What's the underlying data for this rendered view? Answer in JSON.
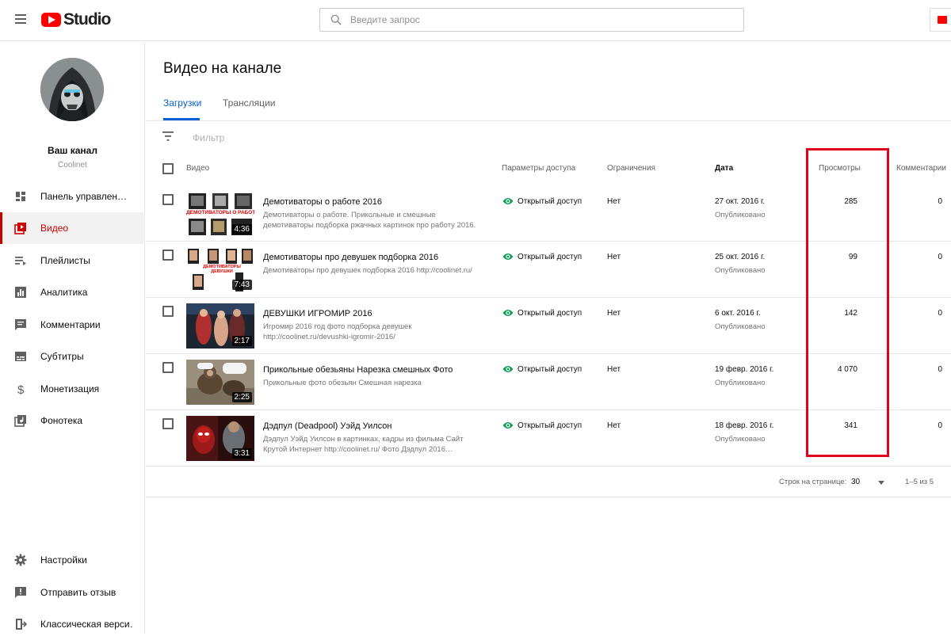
{
  "header": {
    "logo_text": "Studio",
    "search_placeholder": "Введите запрос"
  },
  "channel": {
    "name": "Ваш канал",
    "handle": "Coolinet"
  },
  "sidebar": {
    "items": [
      {
        "label": "Панель управлен…",
        "icon": "dashboard-icon"
      },
      {
        "label": "Видео",
        "icon": "video-icon",
        "active": true
      },
      {
        "label": "Плейлисты",
        "icon": "playlist-icon"
      },
      {
        "label": "Аналитика",
        "icon": "analytics-icon"
      },
      {
        "label": "Комментарии",
        "icon": "comments-icon"
      },
      {
        "label": "Субтитры",
        "icon": "subtitles-icon"
      },
      {
        "label": "Монетизация",
        "icon": "dollar-icon"
      },
      {
        "label": "Фонотека",
        "icon": "audio-library-icon"
      }
    ],
    "bottom_items": [
      {
        "label": "Настройки",
        "icon": "gear-icon"
      },
      {
        "label": "Отправить отзыв",
        "icon": "feedback-icon"
      },
      {
        "label": "Классическая верси…",
        "icon": "exit-icon"
      }
    ]
  },
  "main": {
    "title": "Видео на канале",
    "tabs": [
      {
        "label": "Загрузки",
        "active": true
      },
      {
        "label": "Трансляции"
      }
    ],
    "filter_placeholder": "Фильтр",
    "columns": {
      "video": "Видео",
      "visibility": "Параметры доступа",
      "restrictions": "Ограничения",
      "date": "Дата",
      "views": "Просмотры",
      "comments": "Комментарии"
    },
    "rows": [
      {
        "title": "Демотиваторы о работе 2016",
        "description": "Демотиваторы о работе. Прикольные и смешные демотиваторы подборка ржачных картинок про работу 2016.",
        "duration": "4:36",
        "visibility": "Открытый доступ",
        "restrictions": "Нет",
        "date": "27 окт. 2016 г.",
        "date_status": "Опубликовано",
        "views": "285",
        "comments": "0",
        "thumb_text": "ДЕМОТИВАТОРЫ О РАБОТЕ"
      },
      {
        "title": "Демотиваторы про девушек подборка 2016",
        "description": "Демотиваторы про девушек подборка 2016 http://coolinet.ru/",
        "duration": "7:43",
        "visibility": "Открытый доступ",
        "restrictions": "Нет",
        "date": "25 окт. 2016 г.",
        "date_status": "Опубликовано",
        "views": "99",
        "comments": "0",
        "thumb_text": "ДЕМОТИВАТОРЫ ДЕВУШКИ"
      },
      {
        "title": "ДЕВУШКИ ИГРОМИР 2016",
        "description": "Игромир 2016 год фото подборка девушек http://coolinet.ru/devushki-igromir-2016/",
        "duration": "2:17",
        "visibility": "Открытый доступ",
        "restrictions": "Нет",
        "date": "6 окт. 2016 г.",
        "date_status": "Опубликовано",
        "views": "142",
        "comments": "0"
      },
      {
        "title": "Прикольные обезьяны Нарезка смешных Фото",
        "description": "Прикольные фото обезьян Смешная нарезка",
        "duration": "2:25",
        "visibility": "Открытый доступ",
        "restrictions": "Нет",
        "date": "19 февр. 2016 г.",
        "date_status": "Опубликовано",
        "views": "4 070",
        "comments": "0"
      },
      {
        "title": "Дэдпул (Deadpool) Уэйд Уилсон",
        "description": "Дэдпул Уэйд Уилсон в картинках, кадры из фильма Сайт Крутой Интернет http://coolinet.ru/ Фото Дэдпул 2016…",
        "duration": "3:31",
        "visibility": "Открытый доступ",
        "restrictions": "Нет",
        "date": "18 февр. 2016 г.",
        "date_status": "Опубликовано",
        "views": "341",
        "comments": "0"
      }
    ],
    "pagination": {
      "rows_label": "Строк на странице:",
      "rows_value": "30",
      "range": "1–5 из 5"
    }
  },
  "colors": {
    "brand_red": "#ff0000",
    "active_red": "#cc0000",
    "tab_blue": "#065fd4",
    "visibility_green": "#0f9d58",
    "highlight_box": "#e0001b"
  }
}
